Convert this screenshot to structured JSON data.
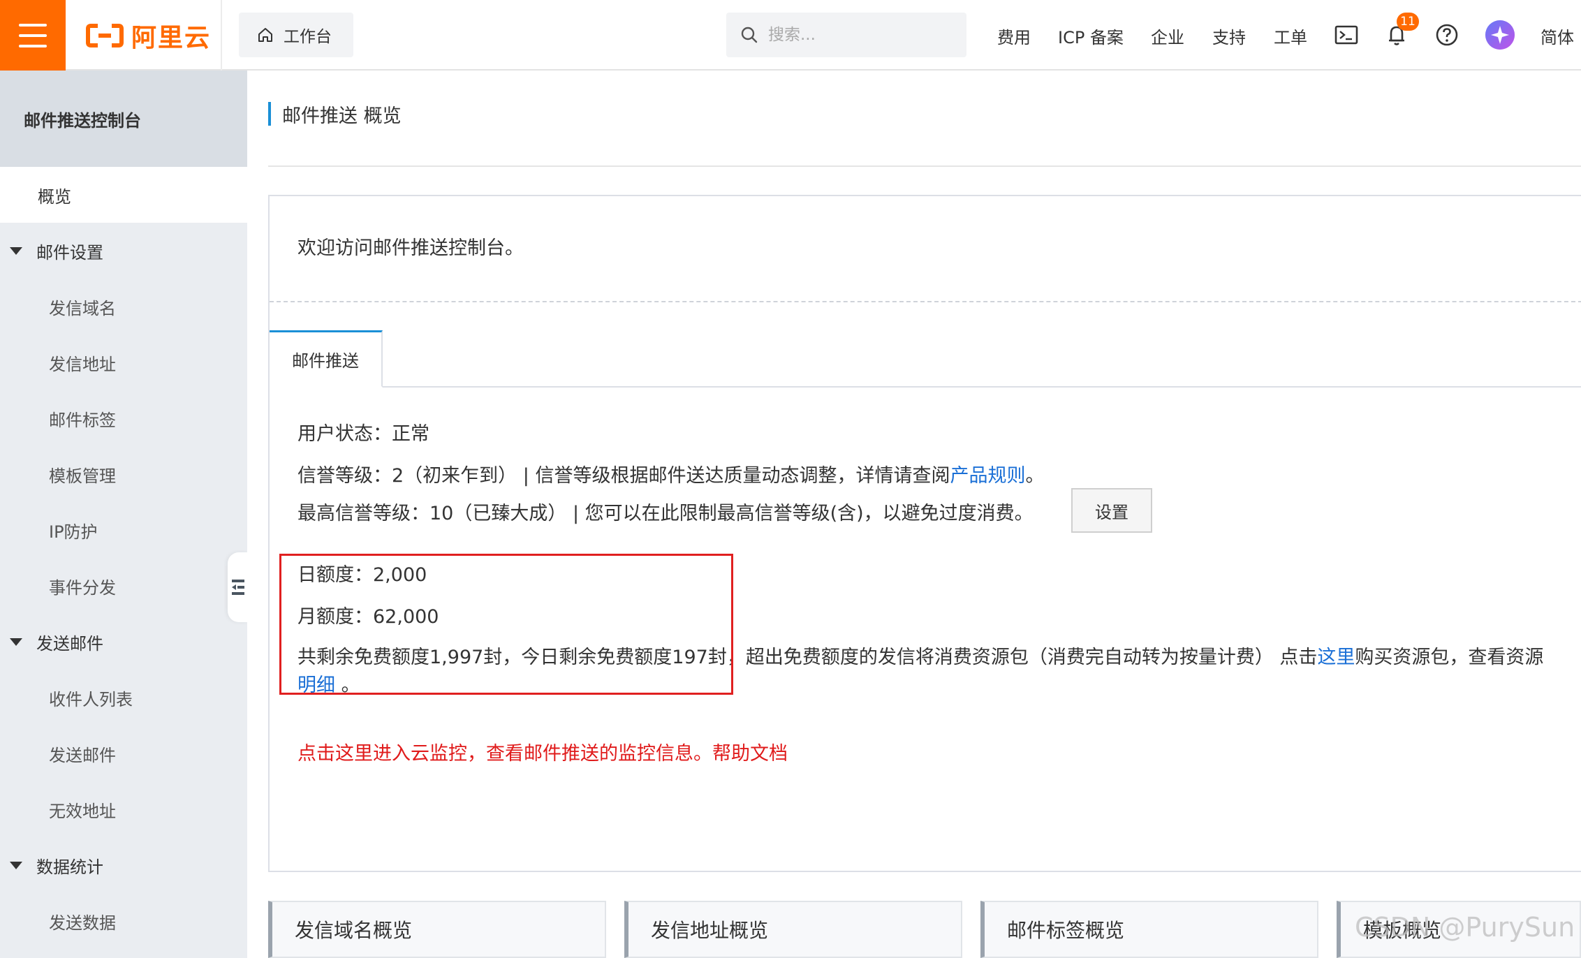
{
  "topbar": {
    "logo_text": "阿里云",
    "workbench_label": "工作台",
    "search_placeholder": "搜索...",
    "nav": [
      "费用",
      "ICP 备案",
      "企业",
      "支持",
      "工单"
    ],
    "notification_count": "11",
    "language_label": "简体",
    "accent_color": "#ff6a00"
  },
  "sidebar": {
    "title": "邮件推送控制台",
    "overview": "概览",
    "groups": [
      {
        "label": "邮件设置",
        "items": [
          "发信域名",
          "发信地址",
          "邮件标签",
          "模板管理",
          "IP防护",
          "事件分发"
        ]
      },
      {
        "label": "发送邮件",
        "items": [
          "收件人列表",
          "发送邮件",
          "无效地址"
        ]
      },
      {
        "label": "数据统计",
        "items": [
          "发送数据"
        ]
      }
    ]
  },
  "main": {
    "page_title": "邮件推送 概览",
    "welcome": "欢迎访问邮件推送控制台。",
    "tab_label": "邮件推送",
    "user_status": "用户状态：正常",
    "reputation_prefix": "信誉等级：2（初来乍到） | 信誉等级根据邮件送达质量动态调整，详情请查阅",
    "reputation_link": "产品规则",
    "reputation_suffix": "。",
    "max_reputation": "最高信誉等级：10（已臻大成） | 您可以在此限制最高信誉等级(含)，以避免过度消费。",
    "set_button": "设置",
    "daily_quota": "日额度：2,000",
    "monthly_quota": "月额度：62,000",
    "free_quota_text": "共剩余免费额度1,997封，今日剩余免费额度197封，超出免费额度的发信将消费资源包（消费完自动转为按量计费）   点击",
    "free_quota_link": "这里",
    "free_quota_after": "购买资源包，查看资源",
    "detail_link": "明细",
    "detail_after": " 。",
    "monitor_text": "点击这里进入云监控，查看邮件推送的监控信息。帮助文档",
    "cards": [
      "发信域名概览",
      "发信地址概览",
      "邮件标签概览",
      "模板概览"
    ]
  },
  "watermark": "CSDN @PurySun",
  "colors": {
    "link": "#1a6fd6",
    "tab_accent": "#1a8fd6",
    "highlight_box": "#e02020",
    "monitor_text": "#e01b1b"
  }
}
